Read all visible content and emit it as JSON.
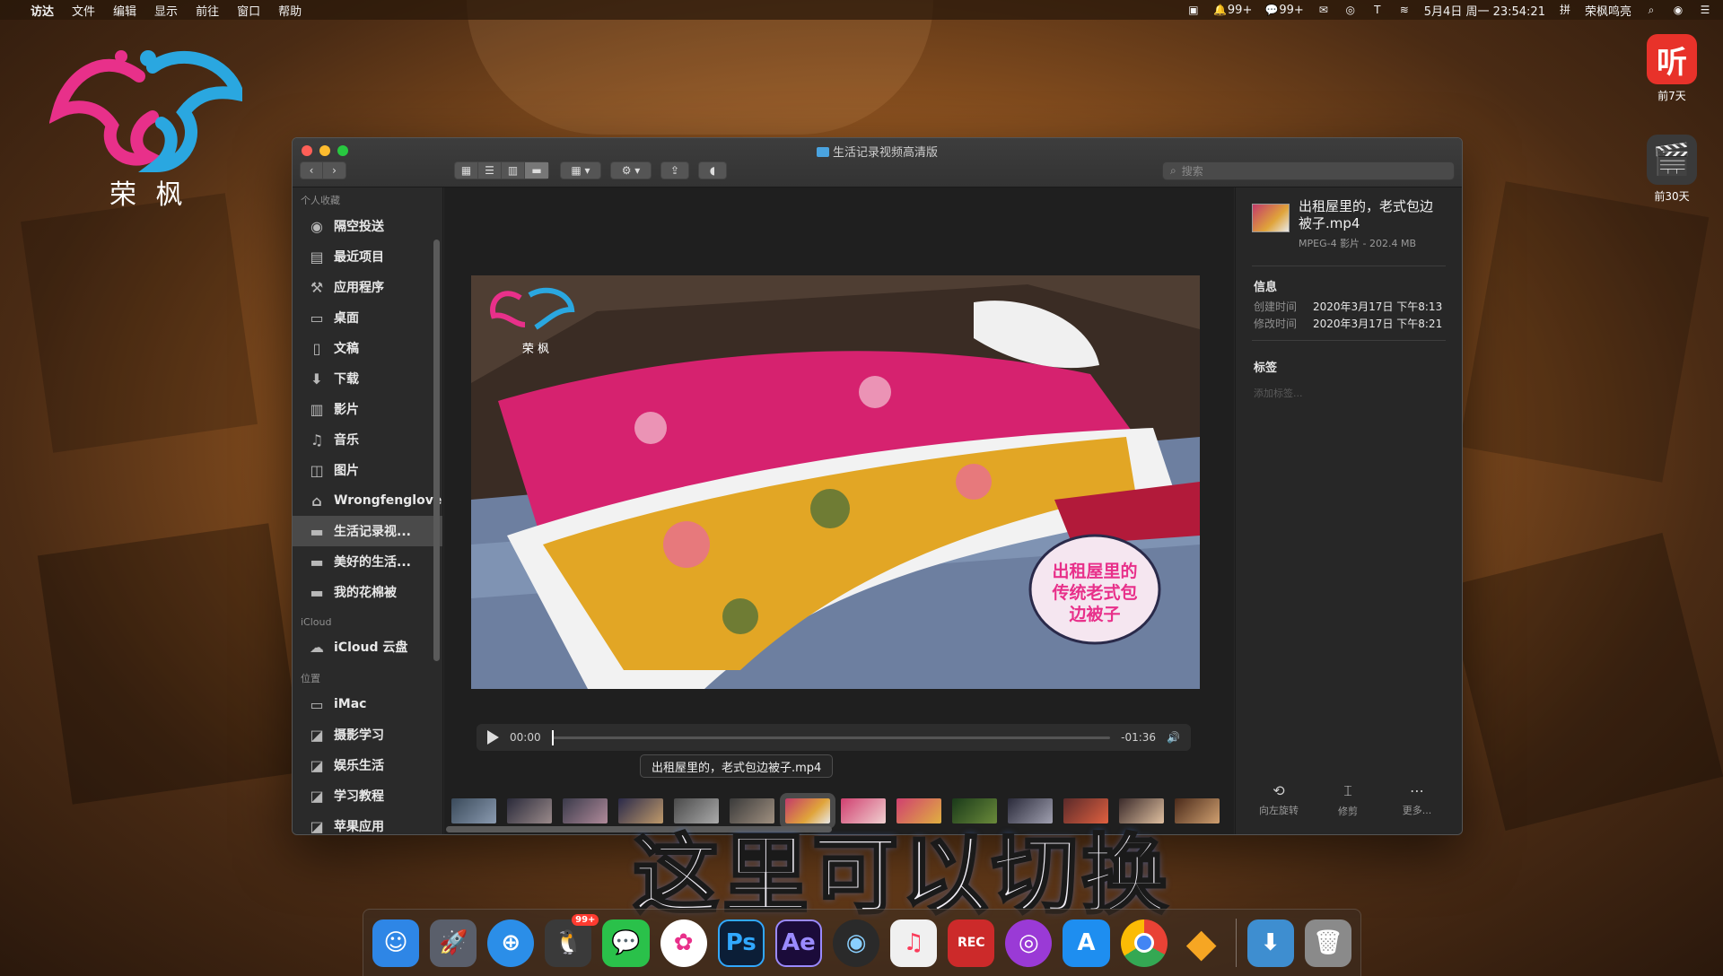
{
  "menubar": {
    "app": "访达",
    "menus": [
      "文件",
      "编辑",
      "显示",
      "前往",
      "窗口",
      "帮助"
    ],
    "status": {
      "notif_count": "99+",
      "wechat_count": "99+",
      "datetime": "5月4日 周一 23:54:21",
      "user": "荣枫鸣亮"
    }
  },
  "brand": {
    "text": "荣 枫"
  },
  "desktop_icons": [
    {
      "label": "前7天",
      "glyph": "听"
    },
    {
      "label": "前30天",
      "glyph": "🎬"
    }
  ],
  "window": {
    "title": "生活记录视频高清版",
    "search_placeholder": "搜索"
  },
  "sidebar": {
    "sections": {
      "favorites": "个人收藏",
      "icloud": "iCloud",
      "locations": "位置"
    },
    "favorites": [
      {
        "label": "隔空投送",
        "icon": "airdrop-icon"
      },
      {
        "label": "最近项目",
        "icon": "recents-icon"
      },
      {
        "label": "应用程序",
        "icon": "applications-icon"
      },
      {
        "label": "桌面",
        "icon": "desktop-icon"
      },
      {
        "label": "文稿",
        "icon": "documents-icon"
      },
      {
        "label": "下载",
        "icon": "downloads-icon"
      },
      {
        "label": "影片",
        "icon": "movies-icon"
      },
      {
        "label": "音乐",
        "icon": "music-icon"
      },
      {
        "label": "图片",
        "icon": "pictures-icon"
      },
      {
        "label": "Wrongfenglove",
        "icon": "home-icon"
      },
      {
        "label": "生活记录视...",
        "icon": "folder-icon",
        "selected": true
      },
      {
        "label": "美好的生活...",
        "icon": "folder-icon"
      },
      {
        "label": "我的花棉被",
        "icon": "folder-icon"
      }
    ],
    "icloud": [
      {
        "label": "iCloud 云盘",
        "icon": "cloud-icon"
      }
    ],
    "locations": [
      {
        "label": "iMac",
        "icon": "imac-icon"
      },
      {
        "label": "摄影学习",
        "icon": "disk-icon"
      },
      {
        "label": "娱乐生活",
        "icon": "disk-icon"
      },
      {
        "label": "学习教程",
        "icon": "disk-icon"
      },
      {
        "label": "苹果应用",
        "icon": "disk-icon"
      }
    ]
  },
  "player": {
    "current_time": "00:00",
    "remaining_time": "-01:36",
    "progress": 0.0,
    "tooltip": "出租屋里的，老式包边被子.mp4",
    "video_logo_text": "荣 枫",
    "video_sticker": "出租屋里的传统老式包边被子"
  },
  "inspector": {
    "file_name": "出租屋里的，老式包边被子.mp4",
    "file_kind": "MPEG-4 影片 - 202.4 MB",
    "info_label": "信息",
    "created_key": "创建时间",
    "created_value": "2020年3月17日 下午8:13",
    "modified_key": "修改时间",
    "modified_value": "2020年3月17日 下午8:21",
    "tags_label": "标签",
    "tags_placeholder": "添加标签...",
    "actions": [
      {
        "label": "向左旋转",
        "icon": "rotate-left-icon"
      },
      {
        "label": "修剪",
        "icon": "trim-icon"
      },
      {
        "label": "更多...",
        "icon": "more-icon"
      }
    ]
  },
  "caption": "这里可以切换",
  "dock_apps": [
    {
      "name": "finder-app",
      "glyph": "☺",
      "color": "#2e86e6"
    },
    {
      "name": "launchpad-app",
      "glyph": "🚀",
      "color": "#5a5f6b"
    },
    {
      "name": "safari-app",
      "glyph": "⊕",
      "color": "#2b8ee8"
    },
    {
      "name": "qq-app",
      "glyph": "🐧",
      "color": "#3a3a3a",
      "badge": "99+"
    },
    {
      "name": "wechat-app",
      "glyph": "💬",
      "color": "#2ac14a"
    },
    {
      "name": "photos-app",
      "glyph": "✿",
      "color": "#ffffff"
    },
    {
      "name": "photoshop-app",
      "glyph": "Ps",
      "color": "#0b1e37"
    },
    {
      "name": "after-effects-app",
      "glyph": "Ae",
      "color": "#1b0b3a"
    },
    {
      "name": "davinci-app",
      "glyph": "◉",
      "color": "#2a2a2a"
    },
    {
      "name": "music-app",
      "glyph": "♫",
      "color": "#f0f0f0"
    },
    {
      "name": "screen-record-app",
      "glyph": "REC",
      "color": "#cc2a2a"
    },
    {
      "name": "podcasts-app",
      "glyph": "◎",
      "color": "#9a3ad6"
    },
    {
      "name": "app-store-app",
      "glyph": "A",
      "color": "#1e8ef0"
    },
    {
      "name": "chrome-app",
      "glyph": "◍",
      "color": "#e0e0e0"
    },
    {
      "name": "sketch-app",
      "glyph": "◆",
      "color": "#f6a623"
    },
    {
      "name": "downloads-stack",
      "glyph": "⬇",
      "color": "#3e8ed0"
    },
    {
      "name": "trash-app",
      "glyph": "🗑",
      "color": "#8a8a8a"
    }
  ],
  "colors": {
    "accent": "#4aa3df",
    "selected": "#4a4a4a",
    "close": "#fe5f57",
    "minimize": "#febc2e",
    "maximize": "#28c840"
  }
}
